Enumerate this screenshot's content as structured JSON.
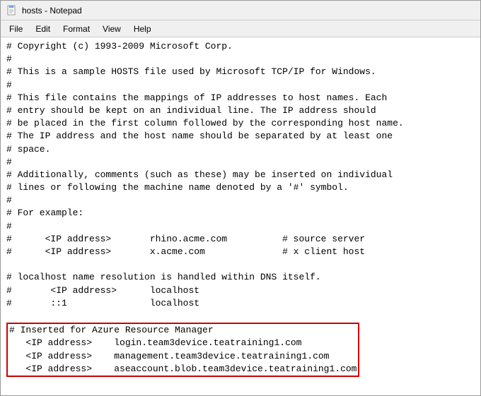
{
  "window": {
    "title": "hosts - Notepad",
    "icon": "notepad-icon"
  },
  "menu": {
    "items": [
      "File",
      "Edit",
      "Format",
      "View",
      "Help"
    ]
  },
  "content": {
    "lines": [
      "# Copyright (c) 1993-2009 Microsoft Corp.",
      "#",
      "# This is a sample HOSTS file used by Microsoft TCP/IP for Windows.",
      "#",
      "# This file contains the mappings of IP addresses to host names. Each",
      "# entry should be kept on an individual line. The IP address should",
      "# be placed in the first column followed by the corresponding host name.",
      "# The IP address and the host name should be separated by at least one",
      "# space.",
      "#",
      "# Additionally, comments (such as these) may be inserted on individual",
      "# lines or following the machine name denoted by a '#' symbol.",
      "#",
      "# For example:",
      "#",
      "#      <IP address>       rhino.acme.com          # source server",
      "#      <IP address>       x.acme.com              # x client host",
      "",
      "# localhost name resolution is handled within DNS itself.",
      "#       <IP address>      localhost",
      "#       ::1               localhost"
    ],
    "highlighted_lines": [
      "# Inserted for Azure Resource Manager",
      "   <IP address>    login.team3device.teatraining1.com",
      "   <IP address>    management.team3device.teatraining1.com",
      "   <IP address>    aseaccount.blob.team3device.teatraining1.com"
    ]
  }
}
